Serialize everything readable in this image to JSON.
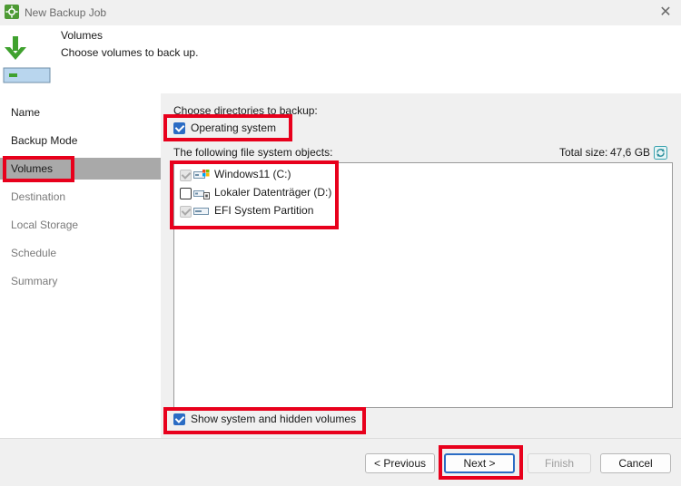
{
  "window": {
    "title": "New Backup Job"
  },
  "header": {
    "title": "Volumes",
    "subtitle": "Choose volumes to back up."
  },
  "sidebar": {
    "items": [
      {
        "label": "Name"
      },
      {
        "label": "Backup Mode"
      },
      {
        "label": "Volumes"
      },
      {
        "label": "Destination"
      },
      {
        "label": "Local Storage"
      },
      {
        "label": "Schedule"
      },
      {
        "label": "Summary"
      }
    ]
  },
  "content": {
    "choose_label": "Choose directories to backup:",
    "os_checkbox": {
      "label": "Operating system",
      "checked": true
    },
    "list_label": "The following file system objects:",
    "total_size_label": "Total size:",
    "total_size_value": "47,6 GB",
    "volumes": [
      {
        "label": "Windows11 (C:)",
        "checked": true,
        "disabled": true,
        "icon": "windows-drive-icon"
      },
      {
        "label": "Lokaler Datenträger (D:)",
        "checked": false,
        "disabled": false,
        "icon": "local-drive-icon"
      },
      {
        "label": "EFI System Partition",
        "checked": true,
        "disabled": true,
        "icon": "partition-icon"
      }
    ],
    "hidden_checkbox": {
      "label": "Show system and hidden volumes",
      "checked": true
    }
  },
  "footer": {
    "previous_label": "< Previous",
    "next_label": "Next >",
    "finish_label": "Finish",
    "cancel_label": "Cancel"
  },
  "colors": {
    "accent": "#2b6cc4",
    "highlight": "#e8001c",
    "brand": "#4d9a34"
  }
}
